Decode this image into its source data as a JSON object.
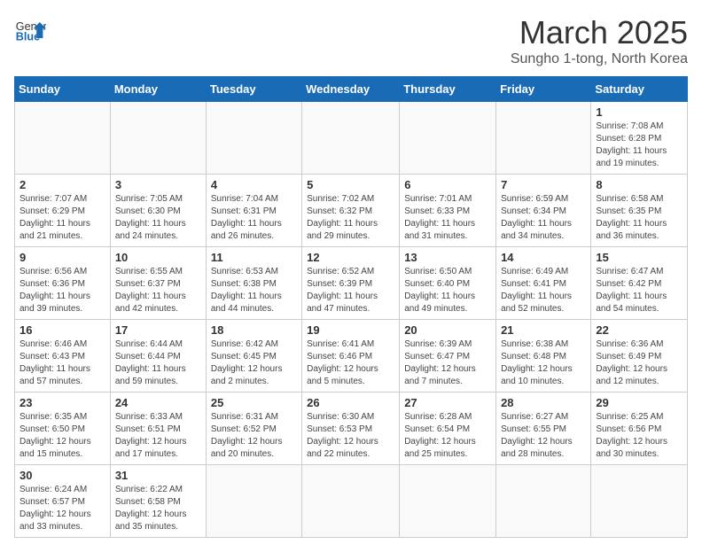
{
  "header": {
    "logo_general": "General",
    "logo_blue": "Blue",
    "title": "March 2025",
    "subtitle": "Sungho 1-tong, North Korea"
  },
  "weekdays": [
    "Sunday",
    "Monday",
    "Tuesday",
    "Wednesday",
    "Thursday",
    "Friday",
    "Saturday"
  ],
  "weeks": [
    [
      {
        "day": "",
        "info": ""
      },
      {
        "day": "",
        "info": ""
      },
      {
        "day": "",
        "info": ""
      },
      {
        "day": "",
        "info": ""
      },
      {
        "day": "",
        "info": ""
      },
      {
        "day": "",
        "info": ""
      },
      {
        "day": "1",
        "info": "Sunrise: 7:08 AM\nSunset: 6:28 PM\nDaylight: 11 hours and 19 minutes."
      }
    ],
    [
      {
        "day": "2",
        "info": "Sunrise: 7:07 AM\nSunset: 6:29 PM\nDaylight: 11 hours and 21 minutes."
      },
      {
        "day": "3",
        "info": "Sunrise: 7:05 AM\nSunset: 6:30 PM\nDaylight: 11 hours and 24 minutes."
      },
      {
        "day": "4",
        "info": "Sunrise: 7:04 AM\nSunset: 6:31 PM\nDaylight: 11 hours and 26 minutes."
      },
      {
        "day": "5",
        "info": "Sunrise: 7:02 AM\nSunset: 6:32 PM\nDaylight: 11 hours and 29 minutes."
      },
      {
        "day": "6",
        "info": "Sunrise: 7:01 AM\nSunset: 6:33 PM\nDaylight: 11 hours and 31 minutes."
      },
      {
        "day": "7",
        "info": "Sunrise: 6:59 AM\nSunset: 6:34 PM\nDaylight: 11 hours and 34 minutes."
      },
      {
        "day": "8",
        "info": "Sunrise: 6:58 AM\nSunset: 6:35 PM\nDaylight: 11 hours and 36 minutes."
      }
    ],
    [
      {
        "day": "9",
        "info": "Sunrise: 6:56 AM\nSunset: 6:36 PM\nDaylight: 11 hours and 39 minutes."
      },
      {
        "day": "10",
        "info": "Sunrise: 6:55 AM\nSunset: 6:37 PM\nDaylight: 11 hours and 42 minutes."
      },
      {
        "day": "11",
        "info": "Sunrise: 6:53 AM\nSunset: 6:38 PM\nDaylight: 11 hours and 44 minutes."
      },
      {
        "day": "12",
        "info": "Sunrise: 6:52 AM\nSunset: 6:39 PM\nDaylight: 11 hours and 47 minutes."
      },
      {
        "day": "13",
        "info": "Sunrise: 6:50 AM\nSunset: 6:40 PM\nDaylight: 11 hours and 49 minutes."
      },
      {
        "day": "14",
        "info": "Sunrise: 6:49 AM\nSunset: 6:41 PM\nDaylight: 11 hours and 52 minutes."
      },
      {
        "day": "15",
        "info": "Sunrise: 6:47 AM\nSunset: 6:42 PM\nDaylight: 11 hours and 54 minutes."
      }
    ],
    [
      {
        "day": "16",
        "info": "Sunrise: 6:46 AM\nSunset: 6:43 PM\nDaylight: 11 hours and 57 minutes."
      },
      {
        "day": "17",
        "info": "Sunrise: 6:44 AM\nSunset: 6:44 PM\nDaylight: 11 hours and 59 minutes."
      },
      {
        "day": "18",
        "info": "Sunrise: 6:42 AM\nSunset: 6:45 PM\nDaylight: 12 hours and 2 minutes."
      },
      {
        "day": "19",
        "info": "Sunrise: 6:41 AM\nSunset: 6:46 PM\nDaylight: 12 hours and 5 minutes."
      },
      {
        "day": "20",
        "info": "Sunrise: 6:39 AM\nSunset: 6:47 PM\nDaylight: 12 hours and 7 minutes."
      },
      {
        "day": "21",
        "info": "Sunrise: 6:38 AM\nSunset: 6:48 PM\nDaylight: 12 hours and 10 minutes."
      },
      {
        "day": "22",
        "info": "Sunrise: 6:36 AM\nSunset: 6:49 PM\nDaylight: 12 hours and 12 minutes."
      }
    ],
    [
      {
        "day": "23",
        "info": "Sunrise: 6:35 AM\nSunset: 6:50 PM\nDaylight: 12 hours and 15 minutes."
      },
      {
        "day": "24",
        "info": "Sunrise: 6:33 AM\nSunset: 6:51 PM\nDaylight: 12 hours and 17 minutes."
      },
      {
        "day": "25",
        "info": "Sunrise: 6:31 AM\nSunset: 6:52 PM\nDaylight: 12 hours and 20 minutes."
      },
      {
        "day": "26",
        "info": "Sunrise: 6:30 AM\nSunset: 6:53 PM\nDaylight: 12 hours and 22 minutes."
      },
      {
        "day": "27",
        "info": "Sunrise: 6:28 AM\nSunset: 6:54 PM\nDaylight: 12 hours and 25 minutes."
      },
      {
        "day": "28",
        "info": "Sunrise: 6:27 AM\nSunset: 6:55 PM\nDaylight: 12 hours and 28 minutes."
      },
      {
        "day": "29",
        "info": "Sunrise: 6:25 AM\nSunset: 6:56 PM\nDaylight: 12 hours and 30 minutes."
      }
    ],
    [
      {
        "day": "30",
        "info": "Sunrise: 6:24 AM\nSunset: 6:57 PM\nDaylight: 12 hours and 33 minutes."
      },
      {
        "day": "31",
        "info": "Sunrise: 6:22 AM\nSunset: 6:58 PM\nDaylight: 12 hours and 35 minutes."
      },
      {
        "day": "",
        "info": ""
      },
      {
        "day": "",
        "info": ""
      },
      {
        "day": "",
        "info": ""
      },
      {
        "day": "",
        "info": ""
      },
      {
        "day": "",
        "info": ""
      }
    ]
  ]
}
